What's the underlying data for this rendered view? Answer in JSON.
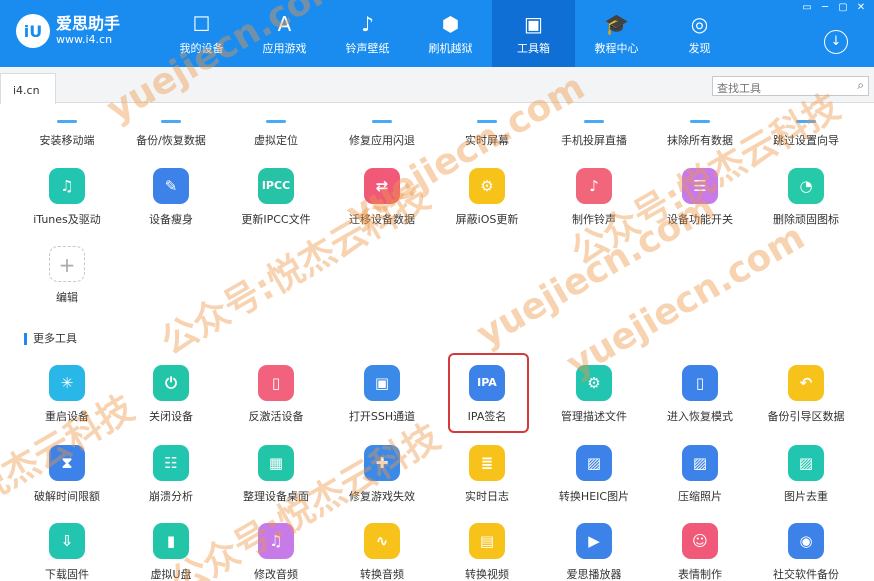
{
  "app": {
    "logo_mark": "iU",
    "title": "爱思助手",
    "url": "www.i4.cn"
  },
  "nav": [
    {
      "label": "我的设备",
      "icon": "☐",
      "active": false
    },
    {
      "label": "应用游戏",
      "icon": "A",
      "active": false
    },
    {
      "label": "铃声壁纸",
      "icon": "♪",
      "active": false
    },
    {
      "label": "刷机越狱",
      "icon": "⬢",
      "active": false
    },
    {
      "label": "工具箱",
      "icon": "▣",
      "active": true
    },
    {
      "label": "教程中心",
      "icon": "🎓",
      "active": false
    },
    {
      "label": "发现",
      "icon": "◎",
      "active": false
    }
  ],
  "window_controls": [
    "▭",
    "─",
    "▢",
    "✕"
  ],
  "download_icon": "↓",
  "tab": {
    "label": "i4.cn"
  },
  "search": {
    "placeholder": "查找工具",
    "value": ""
  },
  "partial_row": [
    "安装移动端",
    "备份/恢复数据",
    "虚拟定位",
    "修复应用闪退",
    "实时屏幕",
    "手机投屏直播",
    "抹除所有数据",
    "跳过设置向导"
  ],
  "row1": [
    {
      "label": "iTunes及驱动",
      "glyph": "♫",
      "color": "#22c5b0"
    },
    {
      "label": "设备瘦身",
      "glyph": "✎",
      "color": "#3c82e8"
    },
    {
      "label": "更新IPCC文件",
      "glyph": "IPCC",
      "color": "#26c3a6"
    },
    {
      "label": "迁移设备数据",
      "glyph": "⇄",
      "color": "#f05a78"
    },
    {
      "label": "屏蔽iOS更新",
      "glyph": "⚙",
      "color": "#f7c21a"
    },
    {
      "label": "制作铃声",
      "glyph": "♪",
      "color": "#f1667a"
    },
    {
      "label": "设备功能开关",
      "glyph": "☰",
      "color": "#c77be8"
    },
    {
      "label": "删除顽固图标",
      "glyph": "◔",
      "color": "#26c9a8"
    }
  ],
  "edit": {
    "label": "编辑",
    "glyph": "+"
  },
  "section": {
    "title": "更多工具"
  },
  "row2": [
    {
      "label": "重启设备",
      "glyph": "✳",
      "color": "#29b7e8"
    },
    {
      "label": "关闭设备",
      "glyph": "⏻",
      "color": "#22c5a8"
    },
    {
      "label": "反激活设备",
      "glyph": "▯",
      "color": "#f2627c"
    },
    {
      "label": "打开SSH通道",
      "glyph": "▣",
      "color": "#3c8ae8"
    },
    {
      "label": "IPA签名",
      "glyph": "IPA",
      "color": "#3c82e8"
    },
    {
      "label": "管理描述文件",
      "glyph": "⚙",
      "color": "#22c5b0"
    },
    {
      "label": "进入恢复模式",
      "glyph": "▯",
      "color": "#3c82e8"
    },
    {
      "label": "备份引导区数据",
      "glyph": "↶",
      "color": "#f7c21a"
    }
  ],
  "row3": [
    {
      "label": "破解时间限额",
      "glyph": "⧗",
      "color": "#3c82e8"
    },
    {
      "label": "崩溃分析",
      "glyph": "☷",
      "color": "#22c5b0"
    },
    {
      "label": "整理设备桌面",
      "glyph": "▦",
      "color": "#22c5a8"
    },
    {
      "label": "修复游戏失效",
      "glyph": "✚",
      "color": "#3c8ae8"
    },
    {
      "label": "实时日志",
      "glyph": "≣",
      "color": "#f7c21a"
    },
    {
      "label": "转换HEIC图片",
      "glyph": "▨",
      "color": "#3c82e8"
    },
    {
      "label": "压缩照片",
      "glyph": "▨",
      "color": "#3c82e8"
    },
    {
      "label": "图片去重",
      "glyph": "▨",
      "color": "#22c5b0"
    }
  ],
  "row4": [
    {
      "label": "下载固件",
      "glyph": "⇩",
      "color": "#22c5b0"
    },
    {
      "label": "虚拟U盘",
      "glyph": "▮",
      "color": "#22c5a8"
    },
    {
      "label": "修改音频",
      "glyph": "♫",
      "color": "#c77be8"
    },
    {
      "label": "转换音频",
      "glyph": "∿",
      "color": "#f7c21a"
    },
    {
      "label": "转换视频",
      "glyph": "▤",
      "color": "#f7c21a"
    },
    {
      "label": "爱思播放器",
      "glyph": "▶",
      "color": "#3c82e8"
    },
    {
      "label": "表情制作",
      "glyph": "☺",
      "color": "#f05a78"
    },
    {
      "label": "社交软件备份",
      "glyph": "◉",
      "color": "#3c82e8"
    }
  ],
  "watermarks": [
    "yuejiecn.com",
    "公众号:悦杰云科技",
    "yuejiecn.com",
    "公众号:悦杰云科技",
    "yuejiecn.com",
    "公众号:悦杰云科技",
    "悦杰云科技",
    "yuejiecn.com"
  ]
}
